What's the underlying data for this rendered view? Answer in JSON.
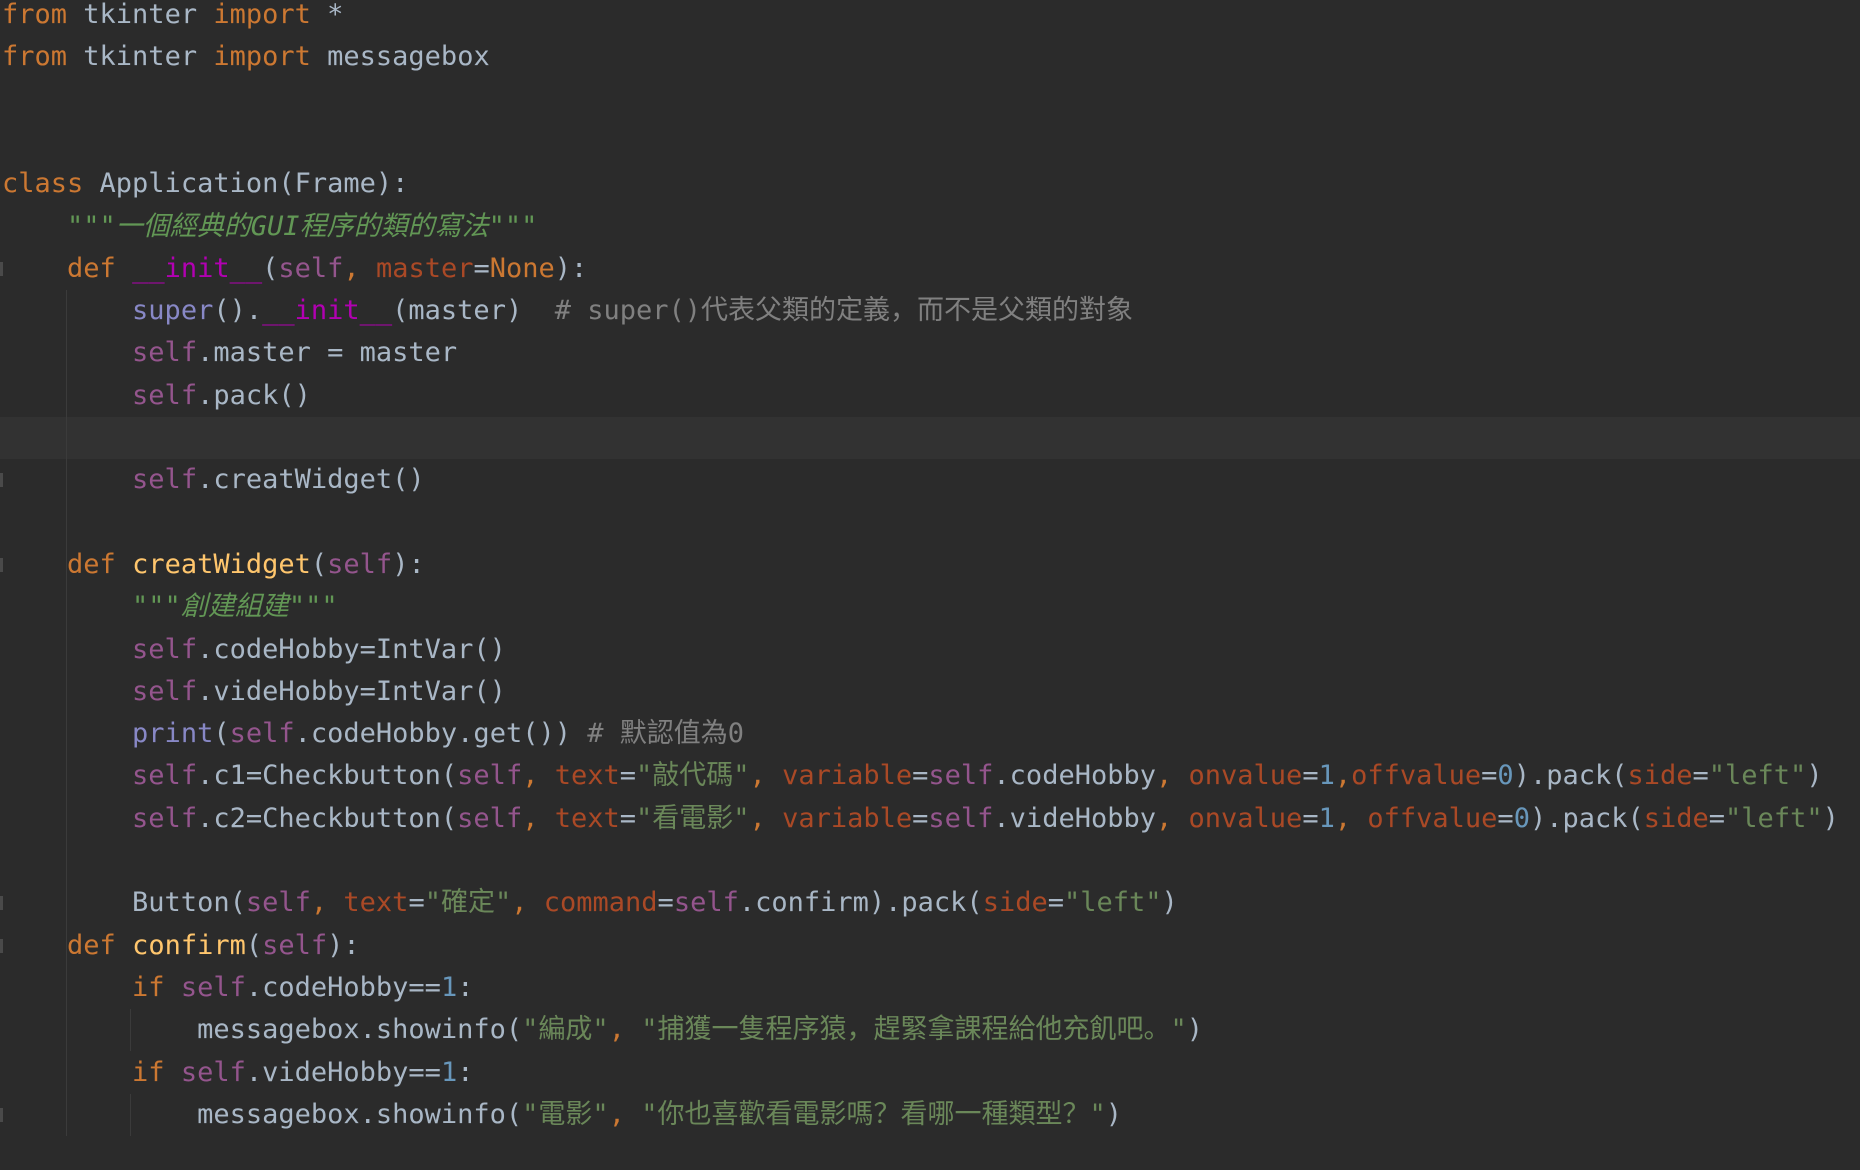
{
  "editor": {
    "language": "python",
    "theme": "darcula",
    "colors": {
      "background": "#2b2b2b",
      "current_line": "#323232",
      "keyword": "#cc7832",
      "string": "#6a8759",
      "self": "#94558d",
      "number": "#6897bb",
      "comment": "#808080",
      "function": "#ffc66d",
      "dunder": "#b200b2",
      "builtin": "#8888c6",
      "text": "#a9b7c6"
    },
    "current_line_number": 11,
    "lines": [
      {
        "t": "from tkinter import *"
      },
      {
        "t": "from tkinter import messagebox"
      },
      {
        "t": ""
      },
      {
        "t": ""
      },
      {
        "t": "class Application(Frame):"
      },
      {
        "t": "    \"\"\"一個經典的GUI程序的類的寫法\"\"\""
      },
      {
        "t": "    def __init__(self, master=None):"
      },
      {
        "t": "        super().__init__(master)  # super()代表父類的定義，而不是父類的對象"
      },
      {
        "t": "        self.master = master"
      },
      {
        "t": "        self.pack()"
      },
      {
        "t": ""
      },
      {
        "t": "        self.creatWidget()"
      },
      {
        "t": ""
      },
      {
        "t": "    def creatWidget(self):"
      },
      {
        "t": "        \"\"\"創建組建\"\"\""
      },
      {
        "t": "        self.codeHobby=IntVar()"
      },
      {
        "t": "        self.videHobby=IntVar()"
      },
      {
        "t": "        print(self.codeHobby.get()) # 默認值為0"
      },
      {
        "t": "        self.c1=Checkbutton(self, text=\"敲代碼\", variable=self.codeHobby, onvalue=1,offvalue=0).pack(side=\"left\")"
      },
      {
        "t": "        self.c2=Checkbutton(self, text=\"看電影\", variable=self.videHobby, onvalue=1, offvalue=0).pack(side=\"left\")"
      },
      {
        "t": ""
      },
      {
        "t": "        Button(self, text=\"確定\", command=self.confirm).pack(side=\"left\")"
      },
      {
        "t": "    def confirm(self):"
      },
      {
        "t": "        if self.codeHobby==1:"
      },
      {
        "t": "            messagebox.showinfo(\"編成\", \"捕獲一隻程序猿，趕緊拿課程給他充飢吧。\")"
      },
      {
        "t": "        if self.videHobby==1:"
      },
      {
        "t": "            messagebox.showinfo(\"電影\", \"你也喜歡看電影嗎？看哪一種類型？\")"
      }
    ]
  }
}
